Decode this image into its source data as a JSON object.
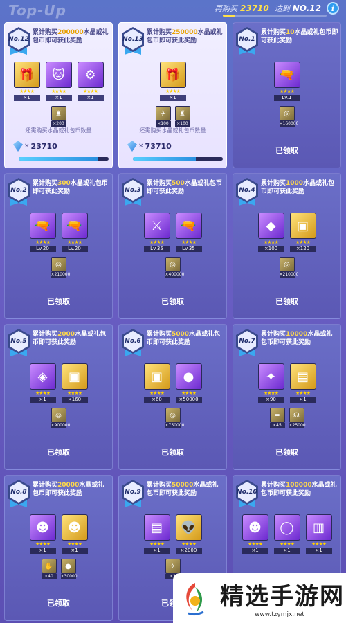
{
  "header": {
    "title": "Top-Up",
    "progress_label": "再购买",
    "progress_value": "23710",
    "tier_label": "达到",
    "tier_value": "NO.12",
    "progress_fraction": 0.12
  },
  "rows": [
    [
      {
        "no": "No.12",
        "state": "pending",
        "desc_pre": "累计购买",
        "desc_hl": "200000",
        "desc_post": "水晶或礼包币即可获此奖励",
        "items": [
          {
            "icon": "gift-box-icon",
            "glyph": "🎁",
            "tone": "gold",
            "qty": "×1"
          },
          {
            "icon": "character-icon",
            "glyph": "🐱",
            "tone": "purple",
            "qty": "×1"
          },
          {
            "icon": "gear-icon",
            "glyph": "⚙",
            "tone": "purple",
            "qty": "×1"
          }
        ],
        "subs": [
          {
            "icon": "armor-icon",
            "glyph": "♜",
            "qty": "×200"
          }
        ],
        "note": "还需购买水晶或礼包币数量",
        "amount": "23710",
        "progress": 0.88
      },
      {
        "no": "No.13",
        "state": "pending",
        "desc_pre": "累计购买",
        "desc_hl": "250000",
        "desc_post": "水晶或礼包币即可获此奖励",
        "items": [
          {
            "icon": "gift-box-icon",
            "glyph": "🎁",
            "tone": "gold",
            "qty": "×1"
          }
        ],
        "subs": [
          {
            "icon": "ship-icon",
            "glyph": "✈",
            "qty": "×100"
          },
          {
            "icon": "armor-icon",
            "glyph": "♜",
            "qty": "×100"
          }
        ],
        "note": "还需购买水晶或礼包币数量",
        "amount": "73710",
        "progress": 0.7
      },
      {
        "no": "No.1",
        "state": "claimed",
        "desc_pre": "累计购买",
        "desc_hl": "10",
        "desc_post": "水晶或礼包币即可获此奖励",
        "items": [
          {
            "icon": "weapon-icon",
            "glyph": "🔫",
            "tone": "purple",
            "qty": "Lv.1"
          }
        ],
        "subs": [
          {
            "icon": "coin-icon",
            "glyph": "◎",
            "qty": "×160000"
          }
        ],
        "status": "已领取"
      }
    ],
    [
      {
        "no": "No.2",
        "state": "claimed",
        "desc_pre": "累计购买",
        "desc_hl": "300",
        "desc_post": "水晶或礼包币即可获此奖励",
        "items": [
          {
            "icon": "weapon-icon",
            "glyph": "🔫",
            "tone": "purple",
            "qty": "Lv.20"
          },
          {
            "icon": "weapon-icon",
            "glyph": "🔫",
            "tone": "purple",
            "qty": "Lv.20"
          }
        ],
        "subs": [
          {
            "icon": "coin-icon",
            "glyph": "◎",
            "qty": "×210000"
          }
        ],
        "status": "已领取"
      },
      {
        "no": "No.3",
        "state": "claimed",
        "desc_pre": "累计购买",
        "desc_hl": "500",
        "desc_post": "水晶或礼包币即可获此奖励",
        "items": [
          {
            "icon": "sword-icon",
            "glyph": "⚔",
            "tone": "purple",
            "qty": "Lv.35"
          },
          {
            "icon": "weapon-icon",
            "glyph": "🔫",
            "tone": "purple",
            "qty": "Lv.35"
          }
        ],
        "subs": [
          {
            "icon": "coin-icon",
            "glyph": "◎",
            "qty": "×400000"
          }
        ],
        "status": "已领取"
      },
      {
        "no": "No.4",
        "state": "claimed",
        "desc_pre": "累计购买",
        "desc_hl": "1000",
        "desc_post": "水晶或礼包币即可获此奖励",
        "items": [
          {
            "icon": "cube-icon",
            "glyph": "◆",
            "tone": "purple",
            "qty": "×100"
          },
          {
            "icon": "chip-icon",
            "glyph": "▣",
            "tone": "gold",
            "qty": "×120"
          }
        ],
        "subs": [
          {
            "icon": "coin-icon",
            "glyph": "◎",
            "qty": "×210000"
          }
        ],
        "status": "已领取"
      }
    ],
    [
      {
        "no": "No.5",
        "state": "claimed",
        "desc_pre": "累计购买",
        "desc_hl": "2000",
        "desc_post": "水晶或礼包币即可获此奖励",
        "items": [
          {
            "icon": "crystal-icon",
            "glyph": "◈",
            "tone": "purple",
            "qty": "×1"
          },
          {
            "icon": "chip-icon",
            "glyph": "▣",
            "tone": "gold",
            "qty": "×160"
          }
        ],
        "subs": [
          {
            "icon": "coin-icon",
            "glyph": "◎",
            "qty": "×900000"
          }
        ],
        "status": "已领取"
      },
      {
        "no": "No.6",
        "state": "claimed",
        "desc_pre": "累计购买",
        "desc_hl": "5000",
        "desc_post": "水晶或礼包币即可获此奖励",
        "items": [
          {
            "icon": "chip-icon",
            "glyph": "▣",
            "tone": "gold",
            "qty": "×60"
          },
          {
            "icon": "orb-icon",
            "glyph": "●",
            "tone": "purple",
            "qty": "×50000"
          }
        ],
        "subs": [
          {
            "icon": "coin-icon",
            "glyph": "◎",
            "qty": "×750000"
          }
        ],
        "status": "已领取"
      },
      {
        "no": "No.7",
        "state": "claimed",
        "desc_pre": "累计购买",
        "desc_hl": "10000",
        "desc_post": "水晶或礼包币即可获此奖励",
        "items": [
          {
            "icon": "drone-icon",
            "glyph": "✦",
            "tone": "purple",
            "qty": "×90"
          },
          {
            "icon": "case-icon",
            "glyph": "▤",
            "tone": "gold",
            "qty": "×1"
          }
        ],
        "subs": [
          {
            "icon": "gun-part-icon",
            "glyph": "╤",
            "qty": "×45"
          },
          {
            "icon": "headset-icon",
            "glyph": "☊",
            "qty": "×25000"
          }
        ],
        "status": "已领取"
      }
    ],
    [
      {
        "no": "No.8",
        "state": "claimed",
        "desc_pre": "累计购买",
        "desc_hl": "20000",
        "desc_post": "水晶或礼包币即可获此奖励",
        "items": [
          {
            "icon": "character-icon",
            "glyph": "☻",
            "tone": "purple",
            "qty": "×1"
          },
          {
            "icon": "character-icon",
            "glyph": "☻",
            "tone": "gold",
            "qty": "×1"
          }
        ],
        "subs": [
          {
            "icon": "claw-icon",
            "glyph": "✋",
            "qty": "×40"
          },
          {
            "icon": "orb-icon",
            "glyph": "●",
            "qty": "×30000"
          }
        ],
        "status": "已领取"
      },
      {
        "no": "No.9",
        "state": "claimed",
        "desc_pre": "累计购买",
        "desc_hl": "50000",
        "desc_post": "水晶或礼包币即可获此奖励",
        "items": [
          {
            "icon": "case-icon",
            "glyph": "▤",
            "tone": "purple",
            "qty": "×1"
          },
          {
            "icon": "alien-icon",
            "glyph": "👽",
            "tone": "gold",
            "qty": "×2000"
          }
        ],
        "subs": [
          {
            "icon": "shard-icon",
            "glyph": "✧",
            "qty": "×1"
          }
        ],
        "status": "已领取"
      },
      {
        "no": "No.10",
        "state": "claimed",
        "desc_pre": "累计购买",
        "desc_hl": "100000",
        "desc_post": "水晶或礼包币即可获此奖励",
        "items": [
          {
            "icon": "character-icon",
            "glyph": "☻",
            "tone": "purple",
            "qty": "×1"
          },
          {
            "icon": "ring-icon",
            "glyph": "◯",
            "tone": "purple",
            "qty": "×1"
          },
          {
            "icon": "console-icon",
            "glyph": "▥",
            "tone": "purple",
            "qty": "×1"
          }
        ],
        "subs": [],
        "status": "已领取"
      }
    ]
  ],
  "watermark": {
    "title": "精选手游网",
    "url": "www.tzymjx.net"
  }
}
